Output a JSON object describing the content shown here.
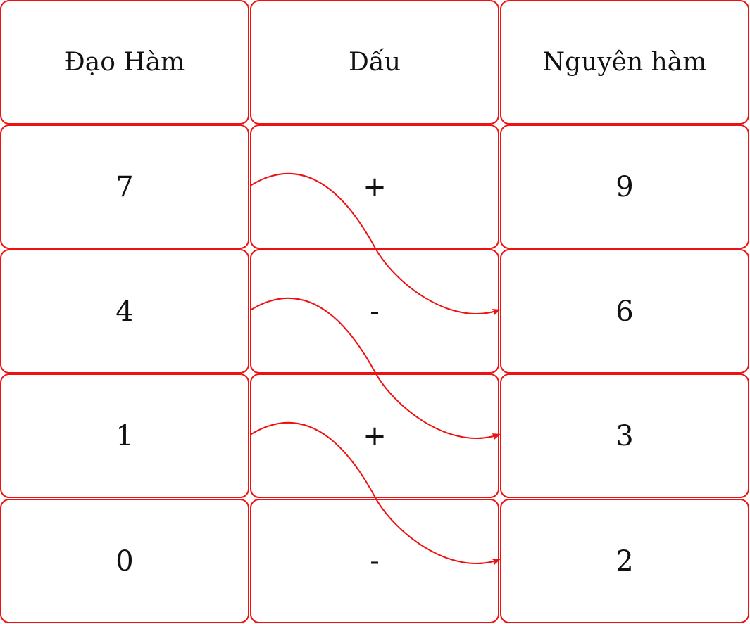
{
  "table": {
    "headers": [
      "Đạo Hàm",
      "Dấu",
      "Nguyên hàm"
    ],
    "rows": [
      {
        "dao_ham": "7",
        "dau": "+",
        "nguyen_ham": "9"
      },
      {
        "dao_ham": "4",
        "dau": "-",
        "nguyen_ham": "6"
      },
      {
        "dao_ham": "1",
        "dau": "+",
        "nguyen_ham": "3"
      },
      {
        "dao_ham": "0",
        "dau": "-",
        "nguyen_ham": "2"
      }
    ]
  },
  "arrows": [
    {
      "from_row": 0,
      "to_row": 1
    },
    {
      "from_row": 1,
      "to_row": 2
    },
    {
      "from_row": 2,
      "to_row": 3
    }
  ],
  "colors": {
    "border": "#ee1111",
    "arrow": "#ee1111",
    "text": "#111111"
  }
}
